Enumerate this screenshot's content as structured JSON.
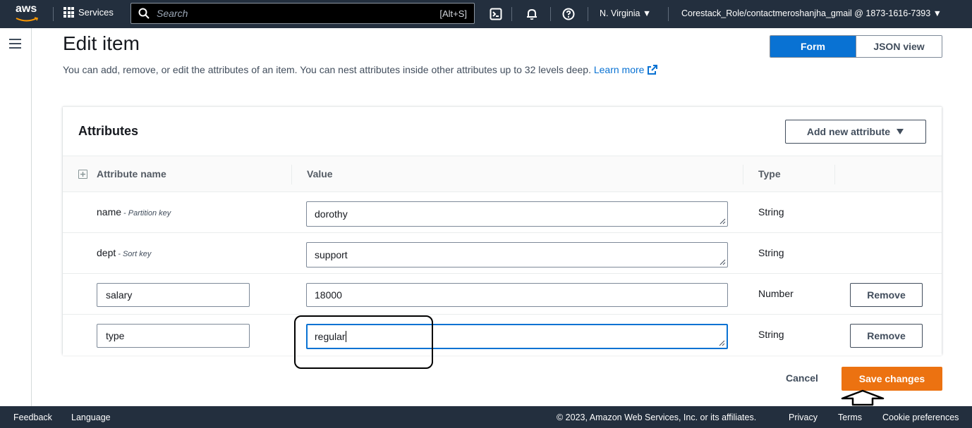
{
  "topnav": {
    "logo_text": "aws",
    "services_label": "Services",
    "search_placeholder": "Search",
    "search_hotkey": "[Alt+S]",
    "region": "N. Virginia ▼",
    "account": "Corestack_Role/contactmeroshanjha_gmail @ 1873-1616-7393 ▼"
  },
  "header": {
    "title": "Edit item",
    "description": "You can add, remove, or edit the attributes of an item. You can nest attributes inside other attributes up to 32 levels deep.",
    "learn_more": "Learn more"
  },
  "view_toggle": {
    "options": [
      "Form",
      "JSON view"
    ],
    "selected": "Form"
  },
  "attributes": {
    "title": "Attributes",
    "add_button": "Add new attribute",
    "columns": {
      "name": "Attribute name",
      "value": "Value",
      "type": "Type"
    },
    "rows": [
      {
        "name": "name",
        "key_type": "- Partition key",
        "value": "dorothy",
        "type": "String"
      },
      {
        "name": "dept",
        "key_type": "- Sort key",
        "value": "support",
        "type": "String"
      },
      {
        "name": "salary",
        "value": "18000",
        "type": "Number",
        "remove": "Remove"
      },
      {
        "name": "type",
        "value": "regular",
        "type": "String",
        "remove": "Remove"
      }
    ]
  },
  "actions": {
    "cancel": "Cancel",
    "save": "Save changes"
  },
  "footer": {
    "feedback": "Feedback",
    "language": "Language",
    "copyright": "© 2023, Amazon Web Services, Inc. or its affiliates.",
    "privacy": "Privacy",
    "terms": "Terms",
    "cookies": "Cookie preferences"
  },
  "colors": {
    "nav_bg": "#232f3e",
    "primary_blue": "#0972d3",
    "save_orange": "#ec7211"
  }
}
